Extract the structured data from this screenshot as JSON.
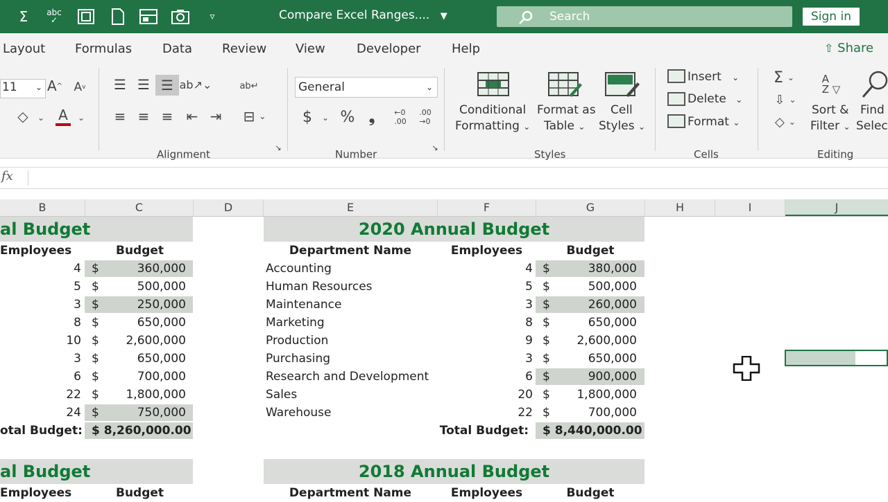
{
  "titlebar": {
    "doc_title": "Compare Excel Ranges....",
    "search_label": "Search",
    "signin_label": "Sign in",
    "qa_icons": [
      "autosum-icon",
      "spelling-icon",
      "form-icon",
      "new-doc-icon",
      "view-icon",
      "camera-icon",
      "customize-icon"
    ]
  },
  "tabs": [
    "Layout",
    "Formulas",
    "Data",
    "Review",
    "View",
    "Developer",
    "Help"
  ],
  "share_label": "Share",
  "ribbon": {
    "font_size": "11",
    "number_format": "General",
    "currency_symbol": "$",
    "percent_symbol": "%",
    "comma_symbol": "❟",
    "styles": {
      "conditional": [
        "Conditional",
        "Formatting"
      ],
      "format_table": [
        "Format as",
        "Table"
      ],
      "cell_styles": [
        "Cell",
        "Styles"
      ]
    },
    "cells": {
      "insert": "Insert",
      "delete": "Delete",
      "format": "Format"
    },
    "editing": {
      "sort": [
        "Sort &",
        "Filter"
      ],
      "find": [
        "Find",
        "Select"
      ]
    },
    "groups": {
      "alignment": "Alignment",
      "number": "Number",
      "styles": "Styles",
      "cells": "Cells",
      "editing": "Editing"
    }
  },
  "formula_bar": {
    "fx": "fx",
    "value": ""
  },
  "columns": [
    "B",
    "C",
    "D",
    "E",
    "F",
    "G",
    "H",
    "I",
    "J"
  ],
  "left_table": {
    "title": "al Budget",
    "headers": {
      "employees": "Employees",
      "budget": "Budget"
    },
    "rows": [
      {
        "emp": "4",
        "cur": "$",
        "budget": "360,000",
        "shaded": true
      },
      {
        "emp": "5",
        "cur": "$",
        "budget": "500,000",
        "shaded": false
      },
      {
        "emp": "3",
        "cur": "$",
        "budget": "250,000",
        "shaded": true
      },
      {
        "emp": "8",
        "cur": "$",
        "budget": "650,000",
        "shaded": false
      },
      {
        "emp": "10",
        "cur": "$",
        "budget": "2,600,000",
        "shaded": false
      },
      {
        "emp": "3",
        "cur": "$",
        "budget": "650,000",
        "shaded": false
      },
      {
        "emp": "6",
        "cur": "$",
        "budget": "700,000",
        "shaded": false
      },
      {
        "emp": "22",
        "cur": "$",
        "budget": "1,800,000",
        "shaded": false
      },
      {
        "emp": "24",
        "cur": "$",
        "budget": "750,000",
        "shaded": true
      }
    ],
    "total_label": "otal Budget:",
    "total_value": "$ 8,260,000.00",
    "second_title": "al Budget",
    "second_headers": {
      "employees": "Employees",
      "budget": "Budget"
    }
  },
  "right_table": {
    "title": "2020 Annual Budget",
    "headers": {
      "dept": "Department Name",
      "employees": "Employees",
      "budget": "Budget"
    },
    "rows": [
      {
        "dept": "Accounting",
        "emp": "4",
        "cur": "$",
        "budget": "380,000",
        "shaded": true
      },
      {
        "dept": "Human Resources",
        "emp": "5",
        "cur": "$",
        "budget": "500,000",
        "shaded": false
      },
      {
        "dept": "Maintenance",
        "emp": "3",
        "cur": "$",
        "budget": "260,000",
        "shaded": true
      },
      {
        "dept": "Marketing",
        "emp": "8",
        "cur": "$",
        "budget": "650,000",
        "shaded": false
      },
      {
        "dept": "Production",
        "emp": "9",
        "cur": "$",
        "budget": "2,600,000",
        "shaded": false
      },
      {
        "dept": "Purchasing",
        "emp": "3",
        "cur": "$",
        "budget": "650,000",
        "shaded": false
      },
      {
        "dept": "Research and Development",
        "emp": "6",
        "cur": "$",
        "budget": "900,000",
        "shaded": true
      },
      {
        "dept": "Sales",
        "emp": "20",
        "cur": "$",
        "budget": "1,800,000",
        "shaded": false
      },
      {
        "dept": "Warehouse",
        "emp": "22",
        "cur": "$",
        "budget": "700,000",
        "shaded": false
      }
    ],
    "total_label": "Total Budget:",
    "total_value": "$ 8,440,000.00",
    "second_title": "2018 Annual Budget",
    "second_headers": {
      "dept": "Department Name",
      "employees": "Employees",
      "budget": "Budget"
    }
  },
  "colors": {
    "accent": "#217346",
    "title_green": "#117a35",
    "band": "#d9dcd9",
    "shade": "#cfd4cf"
  }
}
